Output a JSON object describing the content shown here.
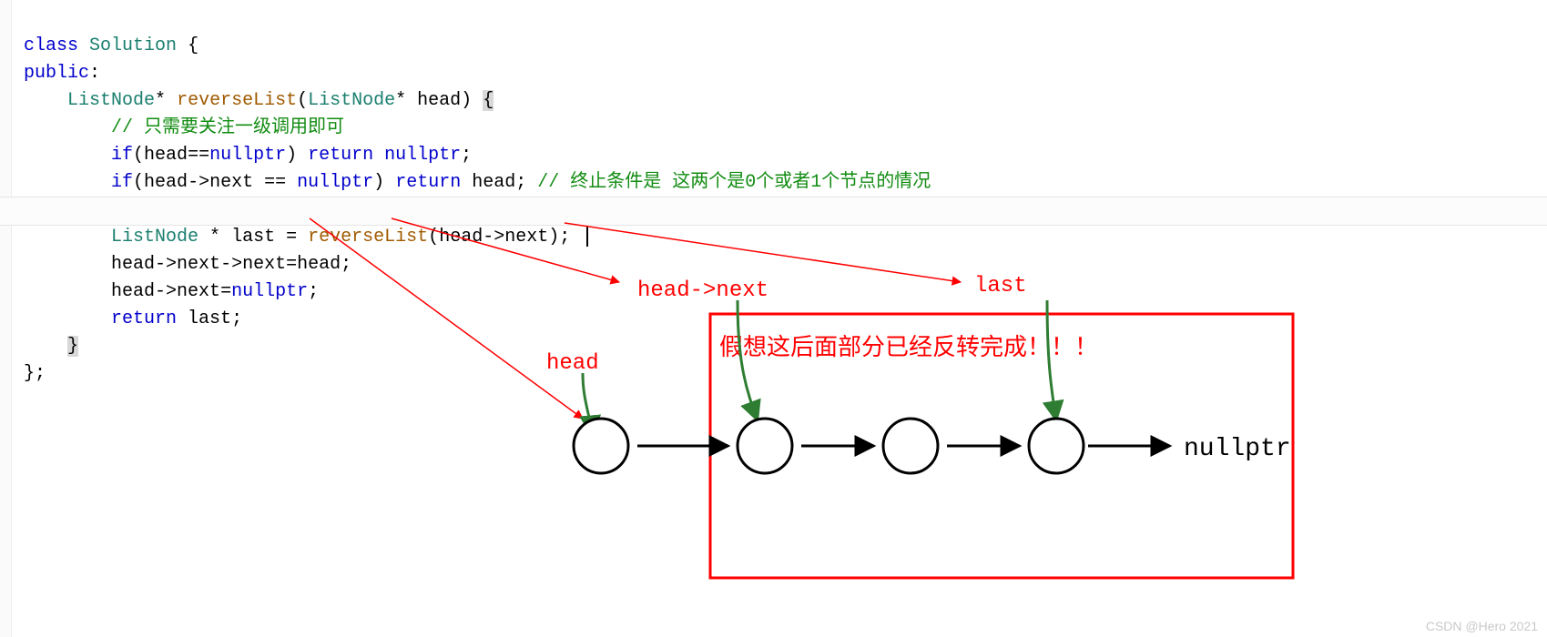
{
  "code": {
    "l1": {
      "kw_class": "class",
      "type": "Solution",
      "brace": "{"
    },
    "l2": {
      "kw_public": "public",
      "colon": ":"
    },
    "l3": {
      "type1": "ListNode",
      "star": "*",
      "fn": "reverseList",
      "paren_l": "(",
      "type2": "ListNode",
      "star2": "*",
      "arg": "head",
      "paren_r": ")",
      "brace": "{"
    },
    "l4": {
      "comment": "// 只需要关注一级调用即可"
    },
    "l5": {
      "kw_if": "if",
      "lp": "(",
      "head": "head",
      "eq": "==",
      "nullp": "nullptr",
      "rp": ")",
      "kw_ret": "return",
      "nullp2": "nullptr",
      "semi": ";"
    },
    "l6": {
      "kw_if": "if",
      "lp": "(",
      "head": "head",
      "arrow": "->",
      "next": "next",
      "eq": "==",
      "nullp": "nullptr",
      "rp": ")",
      "kw_ret": "return",
      "head2": "head",
      "semi": ";",
      "comment": "// 终止条件是 这两个是0个或者1个节点的情况"
    },
    "l8": {
      "type": "ListNode",
      "star": "*",
      "last": "last",
      "eq": "=",
      "fn": "reverseList",
      "lp": "(",
      "head": "head",
      "arrow": "->",
      "next": "next",
      "rp": ")",
      "semi": ";"
    },
    "l9": {
      "head": "head",
      "arrow1": "->",
      "next1": "next",
      "arrow2": "->",
      "next2": "next",
      "eq": "=",
      "head2": "head",
      "semi": ";"
    },
    "l10": {
      "head": "head",
      "arrow": "->",
      "next": "next",
      "eq": "=",
      "nullp": "nullptr",
      "semi": ";"
    },
    "l11": {
      "kw_ret": "return",
      "last": "last",
      "semi": ";"
    },
    "l12": {
      "brace": "}"
    },
    "l13": {
      "brace": "}",
      "semi": ";"
    }
  },
  "diagram": {
    "label_head": "head",
    "label_head_next": "head->next",
    "label_last": "last",
    "annotation": "假想这后面部分已经反转完成！！！",
    "nullptr_label": "nullptr",
    "box_color": "#ff0000",
    "arrow_color_red": "#ff0000",
    "arrow_color_green": "#2e7d32",
    "arrow_color_black": "#000000",
    "nodes": 4
  },
  "watermark": "CSDN @Hero 2021",
  "code_arrows": {
    "src_reverseList_line": 8,
    "targets": [
      "head",
      "head->next",
      "last"
    ]
  }
}
